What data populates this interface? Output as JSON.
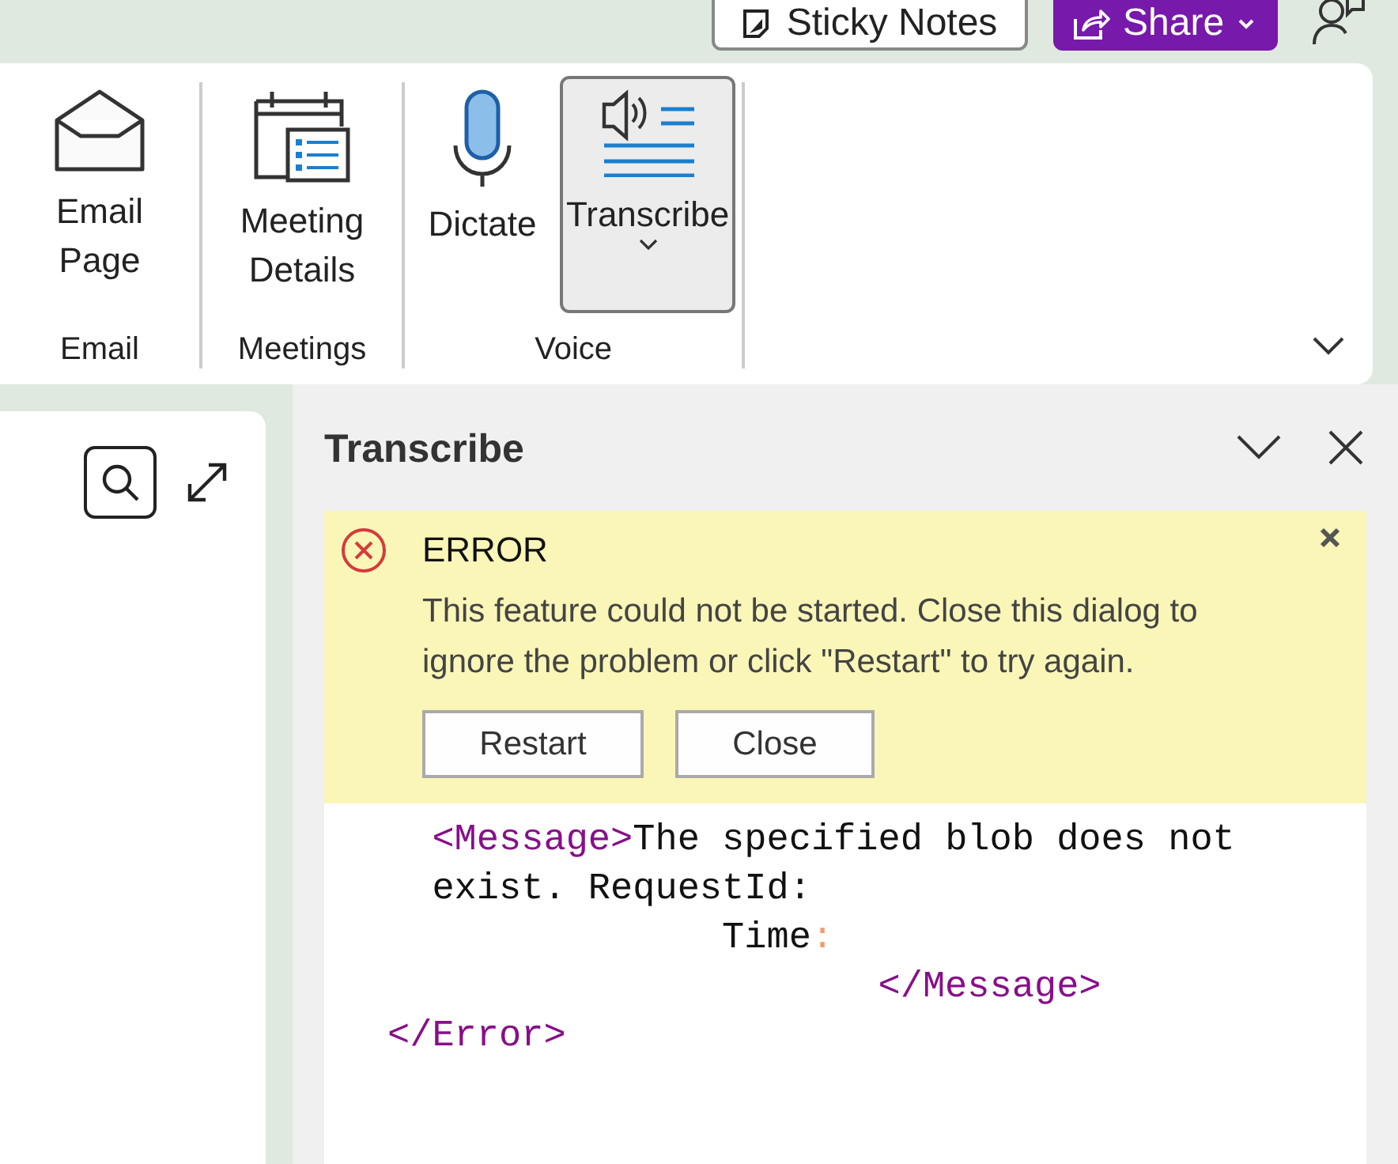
{
  "top_bar": {
    "buttons": [
      {
        "kind": "note",
        "label": "Sticky Notes"
      },
      {
        "kind": "share",
        "label": "Share"
      }
    ]
  },
  "ribbon": {
    "groups": [
      {
        "label": "Email",
        "buttons": [
          {
            "kind": "email",
            "label": "Email Page",
            "selected": false,
            "dropdown": false
          }
        ]
      },
      {
        "label": "Meetings",
        "buttons": [
          {
            "kind": "meeting",
            "label": "Meeting Details",
            "selected": false,
            "dropdown": false
          }
        ]
      },
      {
        "label": "Voice",
        "buttons": [
          {
            "kind": "mic",
            "label": "Dictate",
            "selected": false,
            "dropdown": false
          },
          {
            "kind": "transcribe",
            "label": "Transcribe",
            "selected": true,
            "dropdown": true
          }
        ]
      }
    ]
  },
  "pane": {
    "title": "Transcribe",
    "error": {
      "title": "ERROR",
      "message": "This feature could not be started. Close this dialog to ignore the problem or click \"Restart\" to try again.",
      "buttons": [
        "Restart",
        "Close"
      ]
    },
    "code_lines": [
      {
        "parts": [
          {
            "kind": "tag",
            "text": "  <Message>"
          },
          {
            "kind": "text",
            "text": "The specified blob does not"
          }
        ]
      },
      {
        "parts": [
          {
            "kind": "text",
            "text": "  exist. RequestId:"
          }
        ]
      },
      {
        "parts": [
          {
            "kind": "text",
            "text": "               Time"
          },
          {
            "kind": "punct",
            "text": ":"
          }
        ]
      },
      {
        "parts": [
          {
            "kind": "tag",
            "text": "                      </Message>"
          }
        ]
      },
      {
        "parts": [
          {
            "kind": "tag",
            "text": "</Error>"
          }
        ]
      }
    ]
  }
}
